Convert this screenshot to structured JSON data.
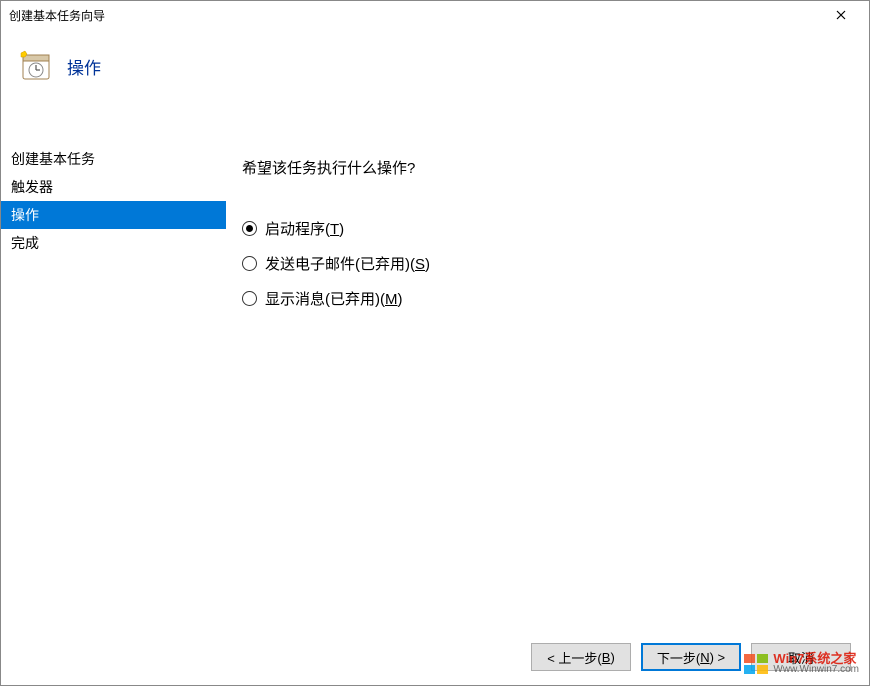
{
  "window": {
    "title": "创建基本任务向导"
  },
  "header": {
    "title": "操作"
  },
  "sidebar": {
    "items": [
      {
        "label": "创建基本任务",
        "selected": false
      },
      {
        "label": "触发器",
        "selected": false
      },
      {
        "label": "操作",
        "selected": true
      },
      {
        "label": "完成",
        "selected": false
      }
    ]
  },
  "main": {
    "question": "希望该任务执行什么操作?",
    "options": [
      {
        "label_pre": "启动程序(",
        "accelerator": "T",
        "label_post": ")",
        "checked": true
      },
      {
        "label_pre": "发送电子邮件(已弃用)(",
        "accelerator": "S",
        "label_post": ")",
        "checked": false
      },
      {
        "label_pre": "显示消息(已弃用)(",
        "accelerator": "M",
        "label_post": ")",
        "checked": false
      }
    ]
  },
  "footer": {
    "back_pre": "< 上一步(",
    "back_accel": "B",
    "back_post": ")",
    "next_pre": "下一步(",
    "next_accel": "N",
    "next_post": ") >",
    "cancel": "取消"
  },
  "watermark": {
    "line1": "Win7系统之家",
    "line2": "Www.Winwin7.com"
  }
}
